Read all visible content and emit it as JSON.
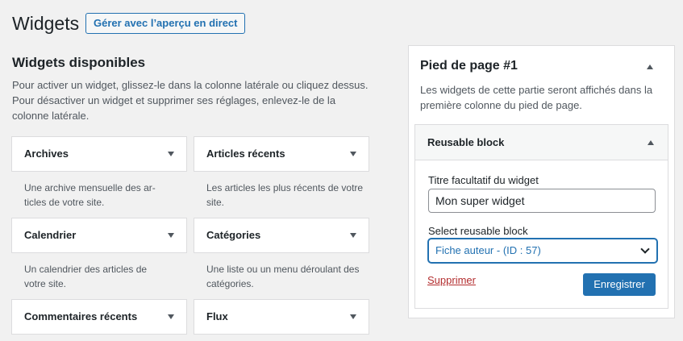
{
  "header": {
    "title": "Widgets",
    "live_preview_label": "Gérer avec l’aperçu en direct"
  },
  "available": {
    "title": "Widgets disponibles",
    "description": "Pour activer un widget, glissez-le dans la colonne latérale ou cliquez dessus. Pour désactiver un widget et supprimer ses réglages, enlevez-le de la colonne latérale.",
    "widgets": [
      {
        "title": "Archives",
        "description": "Une archive mensuelle des ar-ticles de votre site."
      },
      {
        "title": "Articles récents",
        "description": "Les articles les plus récents de votre site."
      },
      {
        "title": "Calendrier",
        "description": "Un calendrier des articles de votre site."
      },
      {
        "title": "Catégories",
        "description": "Une liste ou un menu déroulant des catégories."
      },
      {
        "title": "Commentaires récents",
        "description": ""
      },
      {
        "title": "Flux",
        "description": ""
      }
    ]
  },
  "sidebar": {
    "title": "Pied de page #1",
    "description": "Les widgets de cette partie seront affichés dans la première colonne du pied de page.",
    "widget": {
      "title": "Reusable block",
      "title_field_label": "Titre facultatif du widget",
      "title_field_value": "Mon super widget",
      "select_label": "Select reusable block",
      "select_value": "Fiche auteur - (ID : 57)",
      "delete_label": "Supprimer",
      "save_label": "Enregistrer"
    }
  },
  "icons": {
    "collapse": "chevron-down-icon",
    "expand": "chevron-up-icon",
    "select": "select-chevron-icon"
  },
  "colors": {
    "accent": "#2271b1",
    "delete": "#b32d2e",
    "background": "#f1f1f1"
  }
}
